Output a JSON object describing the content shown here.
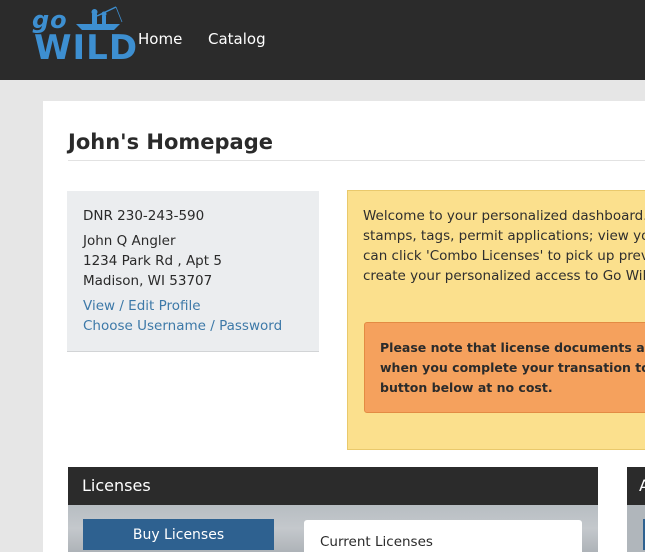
{
  "brand": {
    "logo_top": "go",
    "logo_bottom": "WILD"
  },
  "nav": {
    "home": "Home",
    "catalog": "Catalog"
  },
  "page": {
    "title": "John's Homepage"
  },
  "profile": {
    "dnr": "DNR 230-243-590",
    "name": "John Q Angler",
    "address1": "1234 Park Rd , Apt 5",
    "address2": "Madison, WI 53707",
    "edit_profile": "View / Edit Profile",
    "choose_credentials": "Choose Username / Password"
  },
  "welcome": {
    "lines": [
      "Welcome to your personalized dashboard. I",
      "stamps, tags, permit applications; view your",
      "can click 'Combo Licenses' to pick up previo",
      "create your personalized access to Go Wild."
    ],
    "notice_lines": [
      "Please note that license documents and ta",
      "when you complete your transation to rec",
      "button below at no cost."
    ]
  },
  "licenses": {
    "header": "Licenses",
    "buy_button": "Buy Licenses",
    "current_label": "Current Licenses"
  },
  "right_panel": {
    "header_fragment": "A"
  },
  "colors": {
    "topbar": "#2b2b2b",
    "brand_blue": "#3d8fd1",
    "link_blue": "#3d79a8",
    "welcome_bg": "#fbe08d",
    "notice_bg": "#f5a15d",
    "button_blue": "#2e6190"
  }
}
